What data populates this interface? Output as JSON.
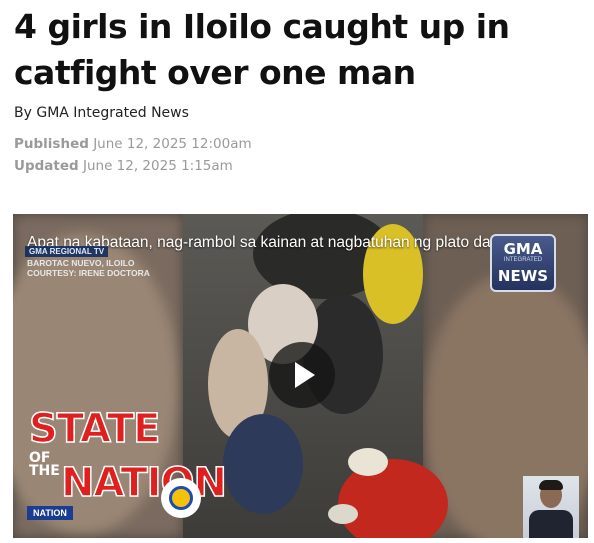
{
  "article": {
    "headline": "4 girls in Iloilo caught up in catfight over one man",
    "byline_prefix": "By",
    "byline_author": "GMA Integrated News",
    "published_label": "Published",
    "published_date": "June 12, 2025 12:00am",
    "updated_label": "Updated",
    "updated_date": "June 12, 2025 1:15am"
  },
  "video": {
    "title": "Apat na kabataan, nag-rambol sa kainan at nagbatuhan ng plato dahil uma...",
    "tag": "GMA REGIONAL TV",
    "location_line1": "BAROTAC NUEVO, ILOILO",
    "location_line2": "COURTESY: IRENE DOCTORA",
    "channel_badge_top": "GMA",
    "channel_badge_mid": "INTEGRATED",
    "channel_badge_bottom": "NEWS",
    "program_line1": "STATE",
    "program_line2": "OF THE",
    "program_line3": "NATION",
    "program_strip": "NATION",
    "play_icon": "play-icon"
  }
}
